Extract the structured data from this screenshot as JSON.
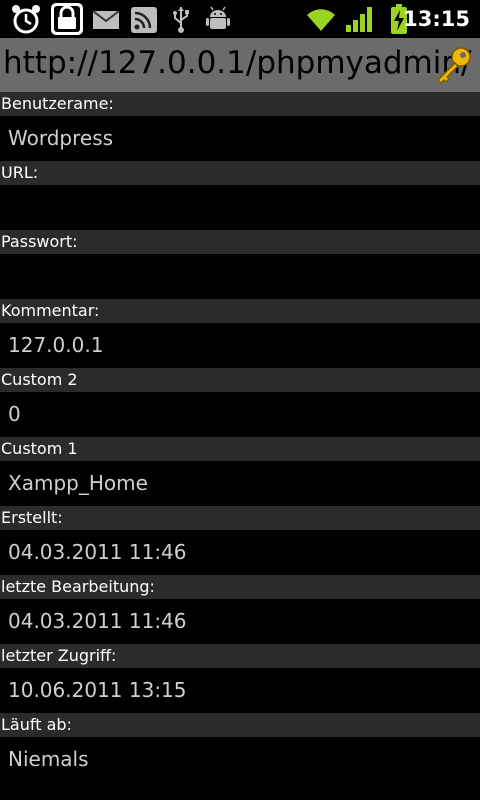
{
  "status_bar": {
    "time": "13:15",
    "icons": [
      "alarm-clock-icon",
      "lock-icon",
      "mail-icon",
      "rss-feed-icon",
      "usb-icon",
      "android-debug-icon",
      "wifi-icon",
      "signal-bars-icon",
      "battery-charging-icon"
    ]
  },
  "title_bar": {
    "title": "http://127.0.0.1/phpmyadmin/",
    "icon": "key-icon"
  },
  "fields": [
    {
      "label": "Benutzerame:",
      "value": "Wordpress"
    },
    {
      "label": "URL:",
      "value": ""
    },
    {
      "label": "Passwort:",
      "value": ""
    },
    {
      "label": "Kommentar:",
      "value": "127.0.0.1"
    },
    {
      "label": "Custom 2",
      "value": "0"
    },
    {
      "label": "Custom 1",
      "value": "Xampp_Home"
    },
    {
      "label": "Erstellt:",
      "value": "04.03.2011 11:46"
    },
    {
      "label": "letzte Bearbeitung:",
      "value": "04.03.2011 11:46"
    },
    {
      "label": "letzter Zugriff:",
      "value": "10.06.2011 13:15"
    },
    {
      "label": "Läuft ab:",
      "value": "Niemals"
    }
  ],
  "colors": {
    "title_bar_bg": "#6b6b6b",
    "label_bg": "#2b2b2b",
    "value_text": "#cfcfcf",
    "status_green": "#9bd323"
  }
}
